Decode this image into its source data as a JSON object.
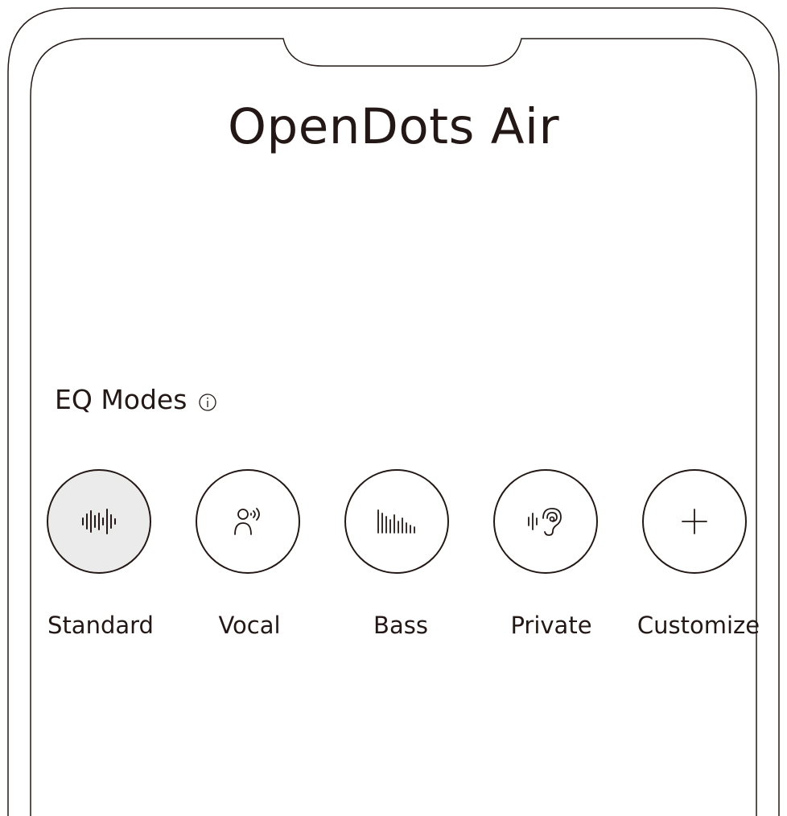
{
  "app": {
    "title": "OpenDots Air"
  },
  "eq": {
    "label": "EQ Modes",
    "info_icon": "info-circle-icon",
    "selected": "Standard",
    "modes": [
      {
        "label": "Standard",
        "icon": "waveform-icon"
      },
      {
        "label": "Vocal",
        "icon": "person-voice-icon"
      },
      {
        "label": "Bass",
        "icon": "bass-bars-icon"
      },
      {
        "label": "Private",
        "icon": "ear-sound-icon"
      },
      {
        "label": "Customize",
        "icon": "plus-icon"
      }
    ]
  },
  "colors": {
    "ink": "#231815",
    "selected_fill": "#ebebeb",
    "background": "#ffffff"
  }
}
